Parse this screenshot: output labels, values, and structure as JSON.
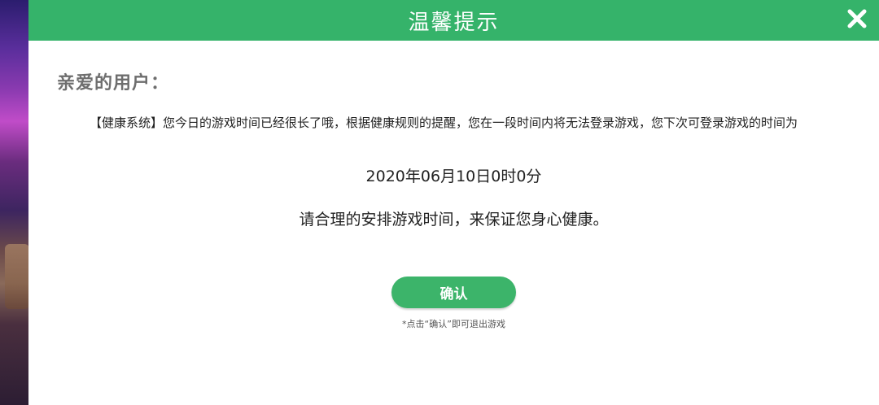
{
  "dialog": {
    "title": "温馨提示",
    "close_icon": "close-icon",
    "greeting": "亲爱的用户：",
    "message": "【健康系统】您今日的游戏时间已经很长了哦，根据健康规则的提醒，您在一段时间内将无法登录游戏，您下次可登录游戏的时间为",
    "unlock_time": "2020年06月10日0时0分",
    "advice": "请合理的安排游戏时间，来保证您身心健康。",
    "confirm_label": "确认",
    "hint": "*点击“确认”即可退出游戏"
  },
  "colors": {
    "header": "#35b36a",
    "button": "#3cb46a",
    "background": "#ffffff",
    "greeting": "#6e6e6e"
  }
}
